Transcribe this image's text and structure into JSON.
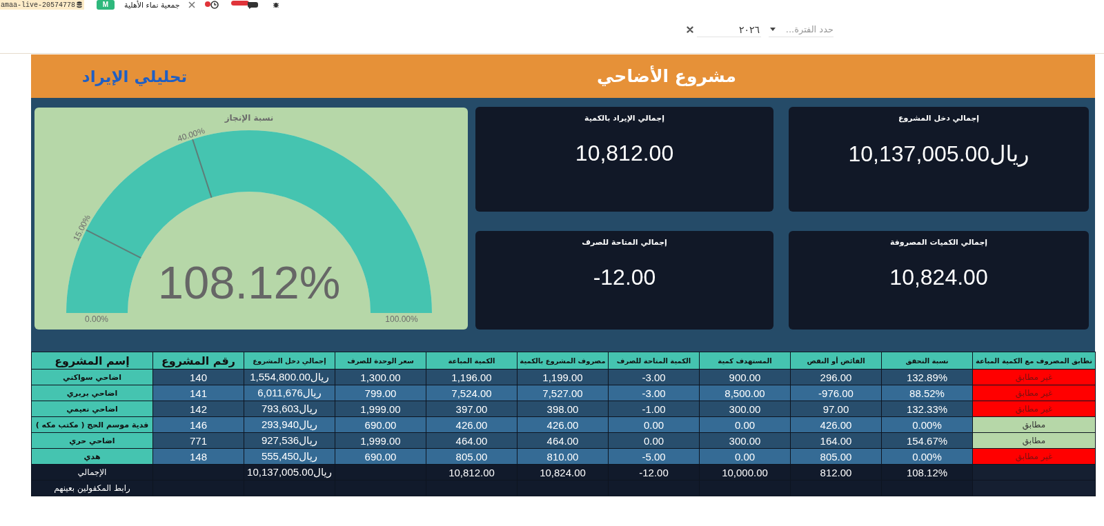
{
  "top_bar": {
    "database": "amaa-live-20574778",
    "avatar_letter": "M",
    "company": "جمعية نماء الأهلية"
  },
  "period_filter": {
    "placeholder": "حدد الفترة...",
    "value": "٢٠٢٦"
  },
  "dashboard": {
    "title": "مشروع الأضاحي",
    "subtitle": "تحليلي الإيراد",
    "cards": [
      {
        "title": "إجمالي دخل المشروع",
        "value": "10,137,005.00ريال"
      },
      {
        "title": "إجمالي الإيراد بالكمية",
        "value": "10,812.00"
      },
      {
        "title": "إجمالي الكميات المصروفة",
        "value": "10,824.00"
      },
      {
        "title": "إجمالي المتاحة للصرف",
        "value": "-12.00"
      }
    ],
    "gauge": {
      "title": "نسبة الإنجاز",
      "value": "108.12%",
      "level": 1,
      "min_label": "0.00%",
      "max_label": "100.00%",
      "markers": [
        {
          "label": "15.00%",
          "level": 0.15
        },
        {
          "label": "40.00%",
          "level": 0.4
        }
      ]
    }
  },
  "table": {
    "columns": [
      "تطابق المصروف مع الكمية المباعة",
      "نسبة التحقق",
      "الفائض أو النقص",
      "المستهدف كمية",
      "الكمية المتاحة للصرف",
      "مصروف المشروع بالكمية",
      "الكمية المباعة",
      "سعر الوحدة للصرف",
      "إجمالي دخل المشروع",
      "رقم المشروع",
      "إسم المشروع"
    ],
    "rows": [
      {
        "matched": false,
        "cells": [
          "غير مطابق",
          "132.89%",
          "296.00",
          "900.00",
          "-3.00",
          "1,199.00",
          "1,196.00",
          "1,300.00",
          "1,554,800.00ريال",
          "140",
          "اضاحي سواكني"
        ]
      },
      {
        "matched": false,
        "cells": [
          "غير مطابق",
          "88.52%",
          "-976.00",
          "8,500.00",
          "-3.00",
          "7,527.00",
          "7,524.00",
          "799.00",
          "6,011,676ريال",
          "141",
          "اضاحي بربري"
        ]
      },
      {
        "matched": false,
        "cells": [
          "غير مطابق",
          "132.33%",
          "97.00",
          "300.00",
          "-1.00",
          "398.00",
          "397.00",
          "1,999.00",
          "793,603ريال",
          "142",
          "اضاحي نعيمي"
        ]
      },
      {
        "matched": true,
        "cells": [
          "مطابق",
          "0.00%",
          "426.00",
          "0.00",
          "0.00",
          "426.00",
          "426.00",
          "690.00",
          "293,940ريال",
          "146",
          "فدية موسم الحج ( مكتب مكه )"
        ]
      },
      {
        "matched": true,
        "cells": [
          "مطابق",
          "154.67%",
          "164.00",
          "300.00",
          "0.00",
          "464.00",
          "464.00",
          "1,999.00",
          "927,536ريال",
          "771",
          "اضاحي حري"
        ]
      },
      {
        "matched": false,
        "cells": [
          "غير مطابق",
          "0.00%",
          "805.00",
          "0.00",
          "-5.00",
          "810.00",
          "805.00",
          "690.00",
          "555,450ريال",
          "148",
          "هدي"
        ]
      }
    ],
    "summary_rows": [
      {
        "cells": [
          null,
          "108.12%",
          "812.00",
          "10,000.00",
          "-12.00",
          "10,824.00",
          "10,812.00",
          null,
          "10,137,005.00ريال",
          null,
          "الإجمالي"
        ]
      },
      {
        "cells": [
          null,
          null,
          null,
          null,
          null,
          null,
          null,
          null,
          null,
          null,
          "رابط المكفولين بعينهم"
        ]
      }
    ]
  }
}
